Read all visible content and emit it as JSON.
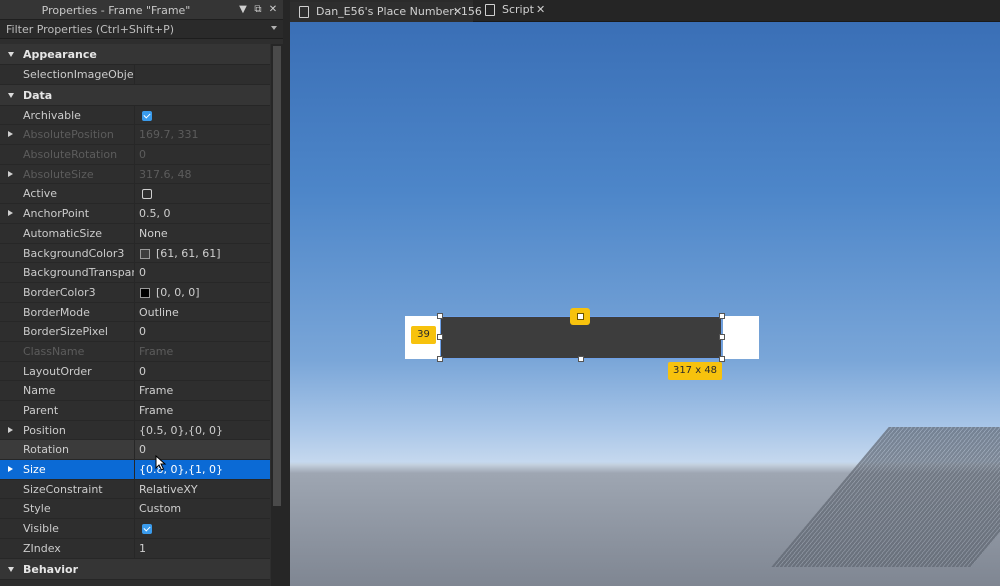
{
  "props_panel": {
    "title": "Properties - Frame \"Frame\"",
    "filter_placeholder": "Filter Properties (Ctrl+Shift+P)",
    "categories": {
      "appearance": "Appearance",
      "data": "Data",
      "behavior": "Behavior"
    },
    "rows": {
      "selection_image_object": {
        "name": "SelectionImageObject",
        "value": ""
      },
      "archivable": {
        "name": "Archivable",
        "checked": true
      },
      "absolute_position": {
        "name": "AbsolutePosition",
        "value": "169.7, 331"
      },
      "absolute_rotation": {
        "name": "AbsoluteRotation",
        "value": "0"
      },
      "absolute_size": {
        "name": "AbsoluteSize",
        "value": "317.6, 48"
      },
      "active": {
        "name": "Active",
        "checked": false
      },
      "anchor_point": {
        "name": "AnchorPoint",
        "value": "0.5, 0"
      },
      "automatic_size": {
        "name": "AutomaticSize",
        "value": "None"
      },
      "background_color3": {
        "name": "BackgroundColor3",
        "value": "[61, 61, 61]",
        "color": "#3d3d3d"
      },
      "background_transparency": {
        "name": "BackgroundTranspare...",
        "value": "0"
      },
      "border_color3": {
        "name": "BorderColor3",
        "value": "[0, 0, 0]",
        "color": "#000000"
      },
      "border_mode": {
        "name": "BorderMode",
        "value": "Outline"
      },
      "border_size_pixel": {
        "name": "BorderSizePixel",
        "value": "0"
      },
      "class_name": {
        "name": "ClassName",
        "value": "Frame"
      },
      "layout_order": {
        "name": "LayoutOrder",
        "value": "0"
      },
      "name": {
        "name": "Name",
        "value": "Frame"
      },
      "parent": {
        "name": "Parent",
        "value": "Frame"
      },
      "position": {
        "name": "Position",
        "value": "{0.5, 0},{0, 0}"
      },
      "rotation": {
        "name": "Rotation",
        "value": "0"
      },
      "size": {
        "name": "Size",
        "value": "{0.8, 0},{1, 0}"
      },
      "size_constraint": {
        "name": "SizeConstraint",
        "value": "RelativeXY"
      },
      "style": {
        "name": "Style",
        "value": "Custom"
      },
      "visible": {
        "name": "Visible",
        "checked": true
      },
      "zindex": {
        "name": "ZIndex",
        "value": "1"
      }
    }
  },
  "tabs": [
    {
      "label": "Dan_E56's Place Number: 156",
      "icon": "place-icon",
      "active": true
    },
    {
      "label": "Script",
      "icon": "script-icon",
      "active": false
    }
  ],
  "viewport": {
    "distance_badge": "39",
    "size_badge": "317 x 48",
    "accent_color": "#f7c20d",
    "selection_color": "#0b6ad5"
  }
}
